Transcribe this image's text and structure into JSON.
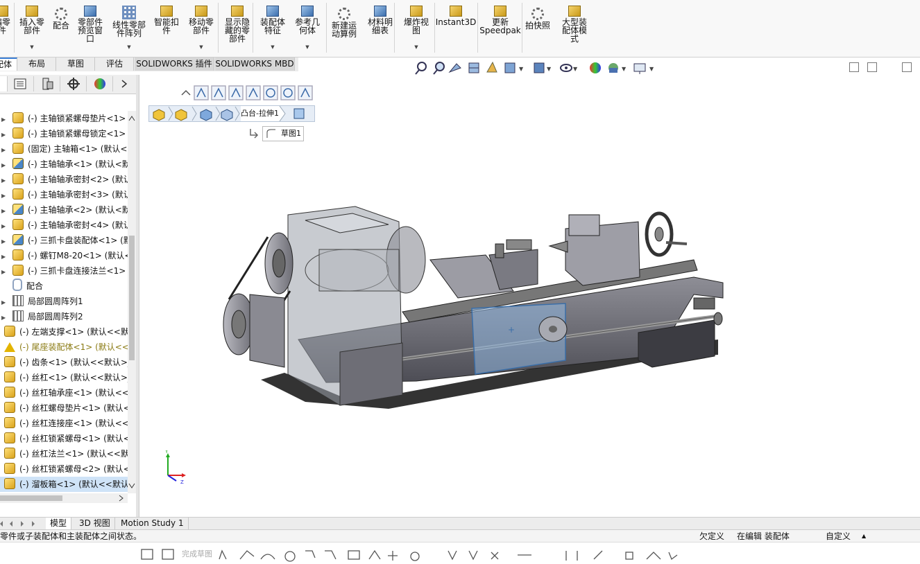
{
  "ribbon": {
    "buttons": [
      {
        "label": "編零\n件",
        "icon": "edit-component-icon",
        "dropdown": false
      },
      {
        "label": "插入零\n部件",
        "icon": "insert-component-icon",
        "dropdown": true
      },
      {
        "label": "配合",
        "icon": "mate-icon",
        "dropdown": false
      },
      {
        "label": "零部件\n预览窗\n口",
        "icon": "component-preview-icon",
        "dropdown": false
      },
      {
        "label": "线性零部\n件阵列",
        "icon": "linear-pattern-icon",
        "dropdown": true
      },
      {
        "label": "智能扣\n件",
        "icon": "smart-fasteners-icon",
        "dropdown": false
      },
      {
        "label": "移动零\n部件",
        "icon": "move-component-icon",
        "dropdown": true
      },
      {
        "label": "显示隐\n藏的零\n部件",
        "icon": "show-hidden-icon",
        "dropdown": false
      },
      {
        "label": "装配体\n特征",
        "icon": "assembly-features-icon",
        "dropdown": true
      },
      {
        "label": "参考几\n何体",
        "icon": "reference-geometry-icon",
        "dropdown": true
      },
      {
        "label": "新建运\n动算例",
        "icon": "motion-study-icon",
        "dropdown": false
      },
      {
        "label": "材料明\n细表",
        "icon": "bom-icon",
        "dropdown": false
      },
      {
        "label": "爆炸视\n图",
        "icon": "exploded-view-icon",
        "dropdown": true
      },
      {
        "label": "Instant3D",
        "icon": "instant3d-icon",
        "dropdown": false
      },
      {
        "label": "更新\nSpeedpak",
        "icon": "speedpak-icon",
        "dropdown": false
      },
      {
        "label": "拍快照",
        "icon": "snapshot-icon",
        "dropdown": false
      },
      {
        "label": "大型装\n配体模\n式",
        "icon": "large-assembly-icon",
        "dropdown": false
      }
    ]
  },
  "tabs": [
    "配体",
    "布局",
    "草图",
    "评估",
    "SOLIDWORKS 插件",
    "SOLIDWORKS MBD"
  ],
  "breadcrumb": {
    "feature": "凸台-拉伸1",
    "sketch": "草图1"
  },
  "tree": [
    {
      "text": "(-) 主轴锁紧螺母垫片<1>",
      "icon": "part",
      "indent": 1,
      "exp": true
    },
    {
      "text": "(-) 主轴锁紧螺母锁定<1>",
      "icon": "part",
      "indent": 1,
      "exp": true
    },
    {
      "text": "(固定) 主轴箱<1> (默认<<",
      "icon": "part",
      "indent": 1,
      "exp": true
    },
    {
      "text": "(-) 主轴轴承<1> (默认<默",
      "icon": "asm",
      "indent": 1,
      "exp": true
    },
    {
      "text": "(-) 主轴轴承密封<2> (默认",
      "icon": "part",
      "indent": 1,
      "exp": true
    },
    {
      "text": "(-) 主轴轴承密封<3> (默认",
      "icon": "part",
      "indent": 1,
      "exp": true
    },
    {
      "text": "(-) 主轴轴承<2> (默认<默",
      "icon": "asm",
      "indent": 1,
      "exp": true
    },
    {
      "text": "(-) 主轴轴承密封<4> (默认",
      "icon": "part",
      "indent": 1,
      "exp": true
    },
    {
      "text": "(-) 三抓卡盘装配体<1> (默",
      "icon": "asm",
      "indent": 1,
      "exp": true
    },
    {
      "text": "(-) 螺钉M8-20<1> (默认<",
      "icon": "part",
      "indent": 1,
      "exp": true
    },
    {
      "text": "(-) 三抓卡盘连接法兰<1>",
      "icon": "part",
      "indent": 1,
      "exp": true
    },
    {
      "text": "配合",
      "icon": "mate",
      "indent": 1,
      "exp": false
    },
    {
      "text": "局部圆周阵列1",
      "icon": "pattern",
      "indent": 1,
      "exp": true
    },
    {
      "text": "局部圆周阵列2",
      "icon": "pattern",
      "indent": 1,
      "exp": true
    },
    {
      "text": "(-) 左端支撑<1> (默认<<默认",
      "icon": "part",
      "indent": 0,
      "exp": false
    },
    {
      "text": "(-) 尾座装配体<1> (默认<<",
      "icon": "warn",
      "indent": 0,
      "exp": false,
      "warn": true
    },
    {
      "text": "(-) 齿条<1> (默认<<默认>_显",
      "icon": "part",
      "indent": 0,
      "exp": false
    },
    {
      "text": "(-) 丝杠<1> (默认<<默认>_显",
      "icon": "part",
      "indent": 0,
      "exp": false
    },
    {
      "text": "(-) 丝杠轴承座<1> (默认<<默",
      "icon": "part",
      "indent": 0,
      "exp": false
    },
    {
      "text": "(-) 丝杠螺母垫片<1> (默认<<",
      "icon": "part",
      "indent": 0,
      "exp": false
    },
    {
      "text": "(-) 丝杠连接座<1> (默认<<默",
      "icon": "part",
      "indent": 0,
      "exp": false
    },
    {
      "text": "(-) 丝杠锁紧螺母<1> (默认<<",
      "icon": "part",
      "indent": 0,
      "exp": false
    },
    {
      "text": "(-) 丝杠法兰<1> (默认<<默认",
      "icon": "part",
      "indent": 0,
      "exp": false
    },
    {
      "text": "(-) 丝杠锁紧螺母<2> (默认<<",
      "icon": "part",
      "indent": 0,
      "exp": false
    },
    {
      "text": "(-) 溜板箱<1> (默认<<默认>_",
      "icon": "part",
      "indent": 0,
      "exp": false,
      "selected": true
    }
  ],
  "bottom_tabs": [
    "模型",
    "3D 视图",
    "Motion Study 1"
  ],
  "status": {
    "message": "指零件或子装配体和主装配体之间状态。",
    "state": "欠定义",
    "editing": "在编辑 装配体",
    "units": "自定义"
  },
  "sketch_toolbar": {
    "complete_label": "完成草图"
  },
  "colors": {
    "accent": "#3c7fd6",
    "selection": "#cfe3f7",
    "warn": "#e3b400"
  }
}
